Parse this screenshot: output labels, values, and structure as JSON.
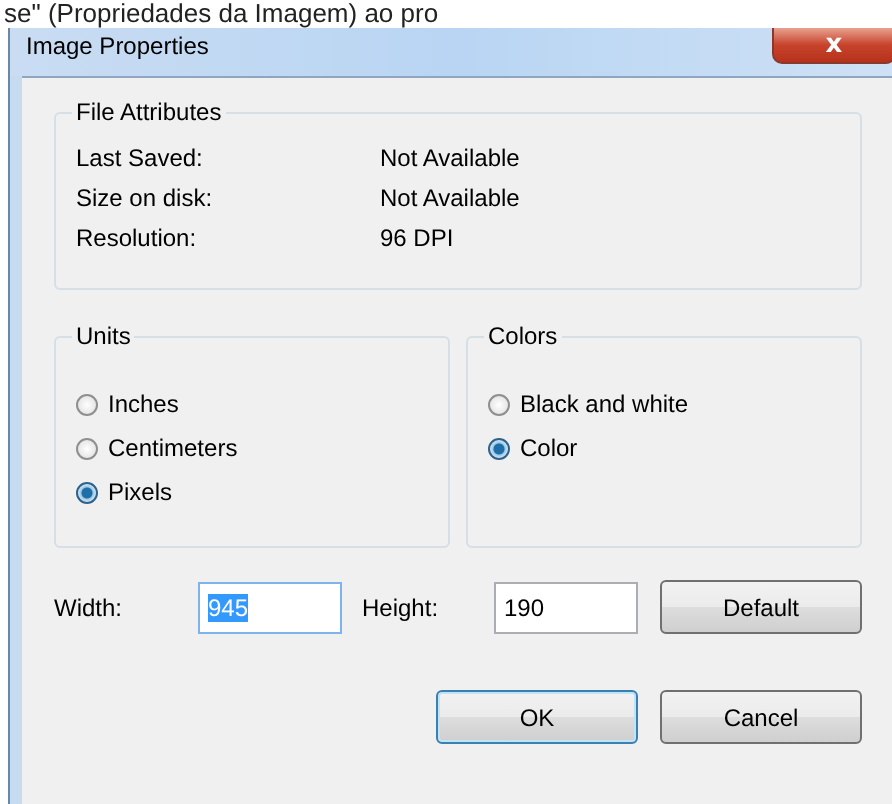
{
  "caption": "se\" (Propriedades da Imagem) ao pro",
  "window": {
    "title": "Image Properties",
    "close": "x"
  },
  "file_attributes": {
    "title": "File Attributes",
    "rows": [
      {
        "label": "Last Saved:",
        "value": "Not Available"
      },
      {
        "label": "Size on disk:",
        "value": "Not Available"
      },
      {
        "label": "Resolution:",
        "value": "96 DPI"
      }
    ]
  },
  "units": {
    "title": "Units",
    "options": [
      {
        "label": "Inches",
        "selected": false
      },
      {
        "label": "Centimeters",
        "selected": false
      },
      {
        "label": "Pixels",
        "selected": true
      }
    ]
  },
  "colors": {
    "title": "Colors",
    "options": [
      {
        "label": "Black and white",
        "selected": false
      },
      {
        "label": "Color",
        "selected": true
      }
    ]
  },
  "size": {
    "width_label": "Width:",
    "width_value": "945",
    "height_label": "Height:",
    "height_value": "190",
    "default_button": "Default"
  },
  "buttons": [
    {
      "label": "OK",
      "default": true
    },
    {
      "label": "Cancel",
      "default": false
    }
  ]
}
